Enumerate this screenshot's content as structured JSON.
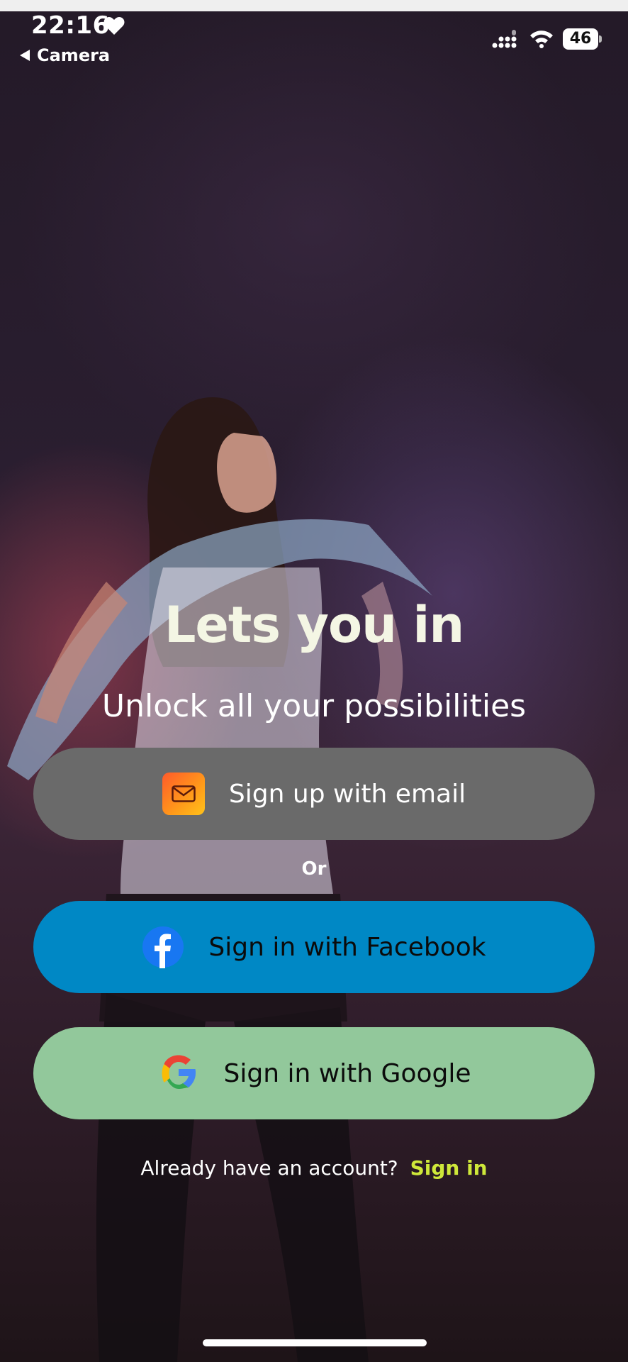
{
  "status_bar": {
    "time": "22:16",
    "battery": "46",
    "back_label": "Camera"
  },
  "hero": {
    "title": "Lets you in",
    "subtitle": "Unlock all your possibilities"
  },
  "buttons": {
    "email": "Sign up with email",
    "or": "Or",
    "facebook": "Sign in with Facebook",
    "google": "Sign in with Google"
  },
  "footer": {
    "prompt": "Already have an account?",
    "link": "Sign in"
  },
  "colors": {
    "email_button": "#6a6a6a",
    "facebook_button": "#0088c5",
    "google_button": "#92c89b",
    "signin_link": "#cfe83a",
    "title": "#f4f6e4"
  },
  "icons": [
    "heart-icon",
    "back-arrow-icon",
    "signal-icon",
    "wifi-icon",
    "battery-icon",
    "mail-icon",
    "facebook-icon",
    "google-icon"
  ]
}
